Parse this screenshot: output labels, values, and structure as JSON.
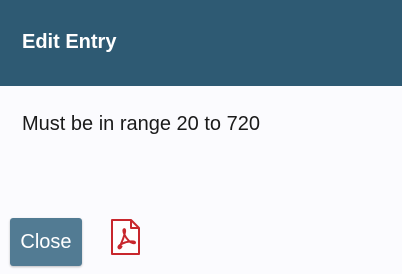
{
  "dialog": {
    "title": "Edit Entry",
    "message": "Must be in range 20 to 720",
    "close_label": "Close",
    "pdf_icon": "pdf-file-icon"
  },
  "colors": {
    "header_background": "#2e5a73",
    "button_background": "#527b93",
    "pdf_icon_red": "#c8272d"
  }
}
